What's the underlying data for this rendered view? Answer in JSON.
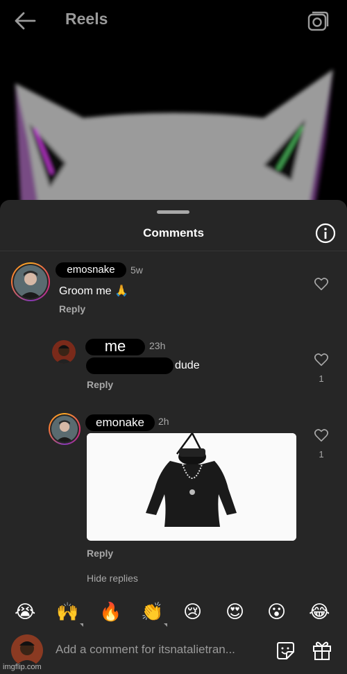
{
  "header": {
    "title": "Reels"
  },
  "sheet": {
    "title": "Comments"
  },
  "comments": [
    {
      "username": "emosnake",
      "time": "5w",
      "text": "Groom me 🙏",
      "reply_label": "Reply"
    }
  ],
  "replies": [
    {
      "username": "me",
      "time": "23h",
      "text": "dude",
      "reply_label": "Reply",
      "likes": "1"
    },
    {
      "username": "emonake",
      "time": "2h",
      "reply_label": "Reply",
      "likes": "1"
    }
  ],
  "hide_replies": "Hide replies",
  "reactions": [
    "😭",
    "🙌",
    "🔥",
    "👏",
    "😢",
    "😍",
    "😮",
    "😂"
  ],
  "composer": {
    "placeholder": "Add a comment for itsnatalietran..."
  },
  "watermark": "imgflip.com",
  "colors": {
    "sheet_bg": "#262626",
    "secondary_text": "#a8a8a8"
  }
}
